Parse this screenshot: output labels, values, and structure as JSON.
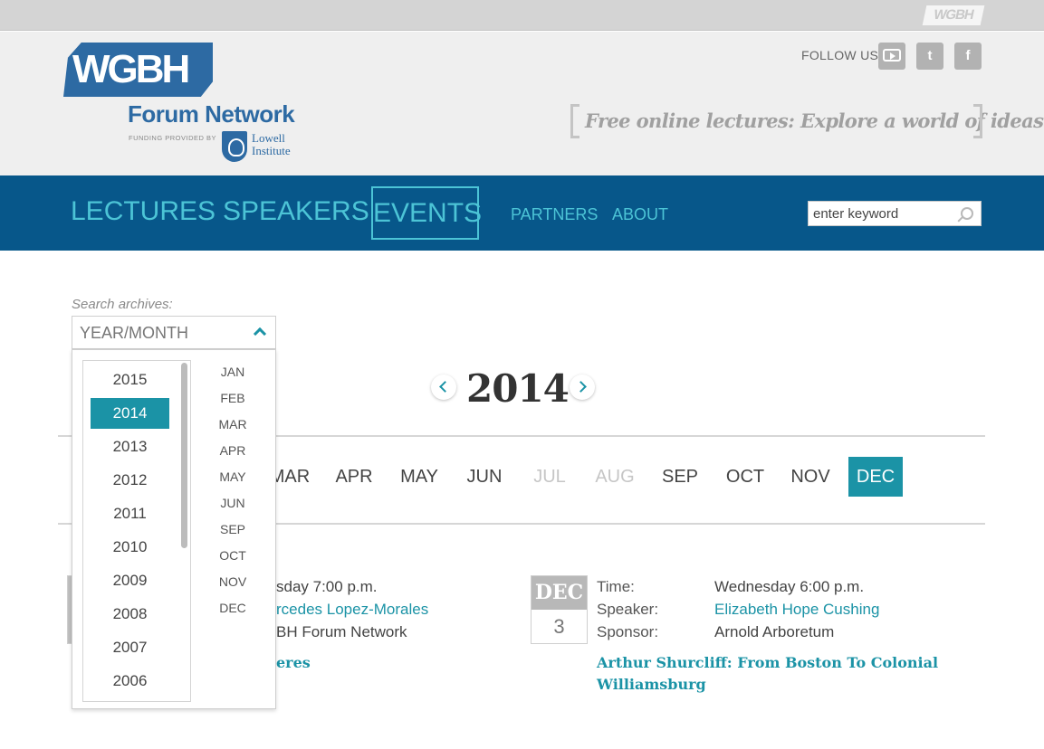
{
  "topbar": {
    "mini_logo": "WGBH"
  },
  "header": {
    "logo": "WGBH",
    "site_name": "Forum Network",
    "funding": "FUNDING PROVIDED BY",
    "sponsor_line1": "Lowell",
    "sponsor_line2": "Institute",
    "follow_label": "FOLLOW US",
    "social": [
      {
        "icon": "youtube-icon"
      },
      {
        "icon": "twitter-icon",
        "glyph": "t"
      },
      {
        "icon": "facebook-icon",
        "glyph": "f"
      }
    ],
    "tagline": "Free online lectures: Explore a world of ideas"
  },
  "nav": {
    "items": [
      "LECTURES",
      "SPEAKERS",
      "EVENTS",
      "PARTNERS",
      "ABOUT"
    ],
    "active": "EVENTS",
    "search_placeholder": "enter keyword"
  },
  "archive": {
    "label": "Search archives:",
    "select_value": "YEAR/MONTH",
    "years": [
      "2015",
      "2014",
      "2013",
      "2012",
      "2011",
      "2010",
      "2009",
      "2008",
      "2007",
      "2006"
    ],
    "selected_year": "2014",
    "months": [
      "JAN",
      "FEB",
      "MAR",
      "APR",
      "MAY",
      "JUN",
      "SEP",
      "OCT",
      "NOV",
      "DEC"
    ]
  },
  "calendar": {
    "year": "2014",
    "month_tabs": [
      {
        "label": "MAR",
        "state": "normal"
      },
      {
        "label": "APR",
        "state": "normal"
      },
      {
        "label": "MAY",
        "state": "normal"
      },
      {
        "label": "JUN",
        "state": "normal"
      },
      {
        "label": "JUL",
        "state": "disabled"
      },
      {
        "label": "AUG",
        "state": "disabled"
      },
      {
        "label": "SEP",
        "state": "normal"
      },
      {
        "label": "OCT",
        "state": "normal"
      },
      {
        "label": "NOV",
        "state": "normal"
      },
      {
        "label": "DEC",
        "state": "active"
      }
    ]
  },
  "events": [
    {
      "time_partial": "sday 7:00 p.m.",
      "speaker_partial": "rcedes Lopez-Morales",
      "sponsor_partial": "BH Forum Network",
      "title_partial": "eres"
    },
    {
      "date_month": "DEC",
      "date_day": "3",
      "time_label": "Time:",
      "time": "Wednesday 6:00 p.m.",
      "speaker_label": "Speaker:",
      "speaker": "Elizabeth Hope Cushing",
      "sponsor_label": "Sponsor:",
      "sponsor": "Arnold Arboretum",
      "title_line1": "Arthur Shurcliff: From Boston To Colonial",
      "title_line2": "Williamsburg"
    }
  ],
  "colors": {
    "nav_bg": "#07578a",
    "nav_text": "#4cc4d6",
    "accent": "#1b93a6",
    "brand_blue": "#2d6aa3"
  }
}
